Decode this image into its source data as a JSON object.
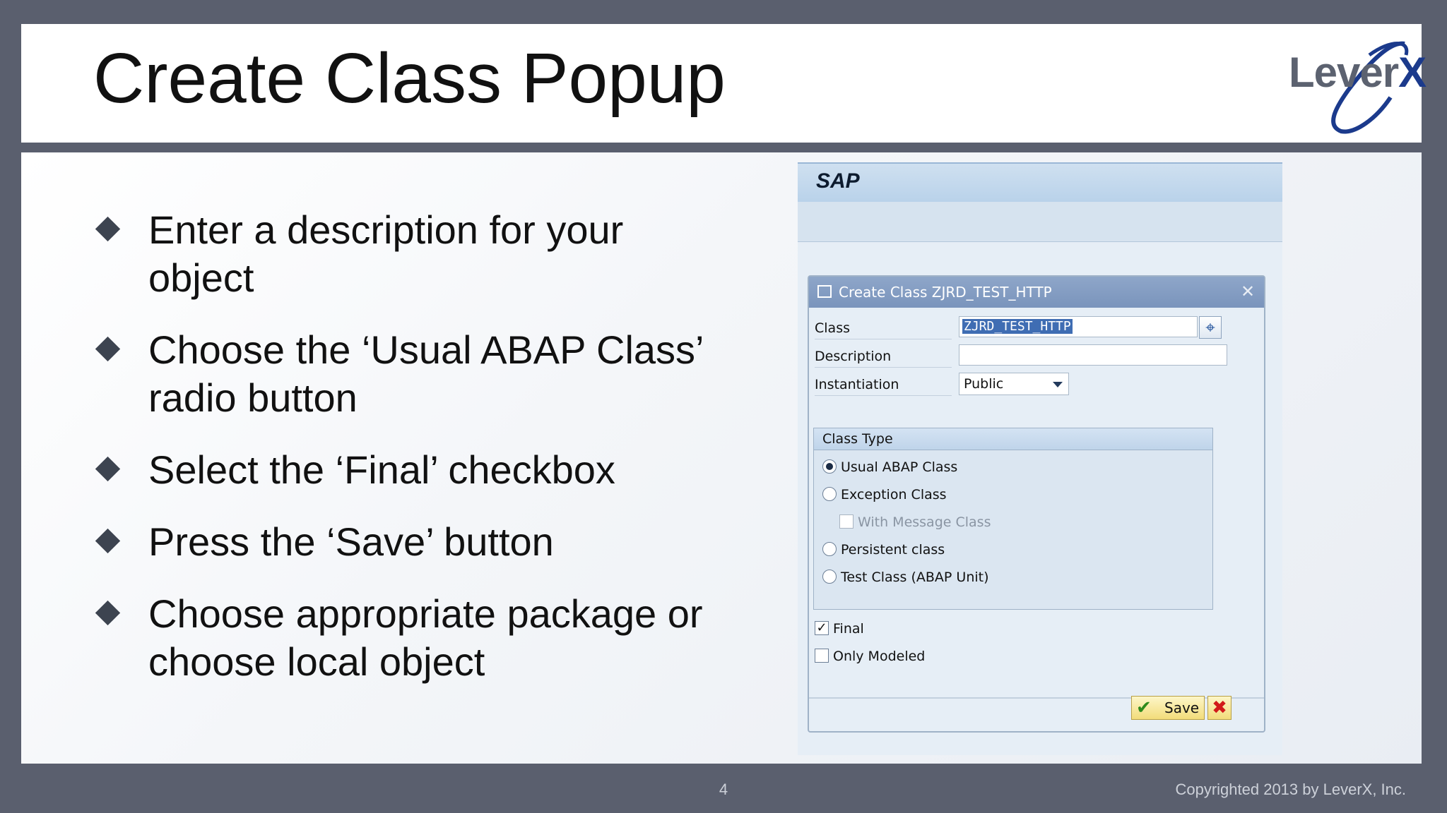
{
  "slide": {
    "title": "Create Class Popup",
    "page_number": "4",
    "copyright": "Copyrighted 2013 by LeverX, Inc."
  },
  "logo": {
    "text_main": "Lever",
    "text_accent": "X",
    "brand_color": "#1b3a8c"
  },
  "bullets": [
    "Enter a description for your object",
    "Choose the ‘Usual ABAP Class’ radio button",
    "Select the ‘Final’ checkbox",
    "Press the ‘Save’ button",
    "Choose appropriate package or choose local object"
  ],
  "sap": {
    "logo": "SAP",
    "dialog": {
      "title": "Create Class ZJRD_TEST_HTTP",
      "fields": {
        "class_label": "Class",
        "class_value": "ZJRD_TEST_HTTP",
        "description_label": "Description",
        "description_value": "",
        "instantiation_label": "Instantiation",
        "instantiation_value": "Public"
      },
      "class_type": {
        "heading": "Class Type",
        "options": [
          {
            "label": "Usual ABAP Class",
            "selected": true
          },
          {
            "label": "Exception Class",
            "selected": false
          },
          {
            "label": "With Message Class",
            "checked": false,
            "disabled": true
          },
          {
            "label": "Persistent class",
            "selected": false
          },
          {
            "label": "Test Class (ABAP Unit)",
            "selected": false
          }
        ]
      },
      "final": {
        "label": "Final",
        "checked": true
      },
      "only_modeled": {
        "label": "Only Modeled",
        "checked": false
      },
      "save_label": "Save"
    }
  }
}
